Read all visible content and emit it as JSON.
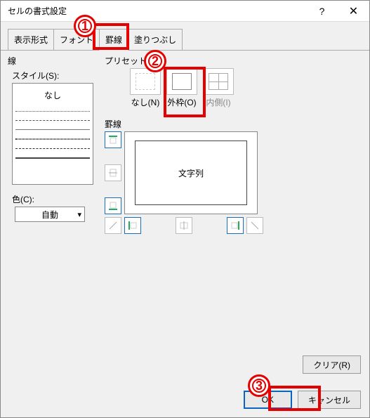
{
  "title": "セルの書式設定",
  "help_icon": "?",
  "close_icon": "✕",
  "tabs": {
    "t0": "表示形式",
    "t1": "フォント",
    "t2": "罫線",
    "t3": "塗りつぶし"
  },
  "sen_label": "線",
  "style_label": "スタイル(S):",
  "style_none": "なし",
  "color_label": "色(C):",
  "color_value": "自動",
  "preset_label": "プリセット",
  "presets": {
    "none": "なし(N)",
    "outline": "外枠(O)",
    "inside": "内側(I)"
  },
  "keisen_label": "罫線",
  "preview_text": "文字列",
  "clear_label": "クリア(R)",
  "ok_label": "OK",
  "cancel_label": "キャンセル",
  "annotations": {
    "a1": "1",
    "a2": "2",
    "a3": "3"
  }
}
